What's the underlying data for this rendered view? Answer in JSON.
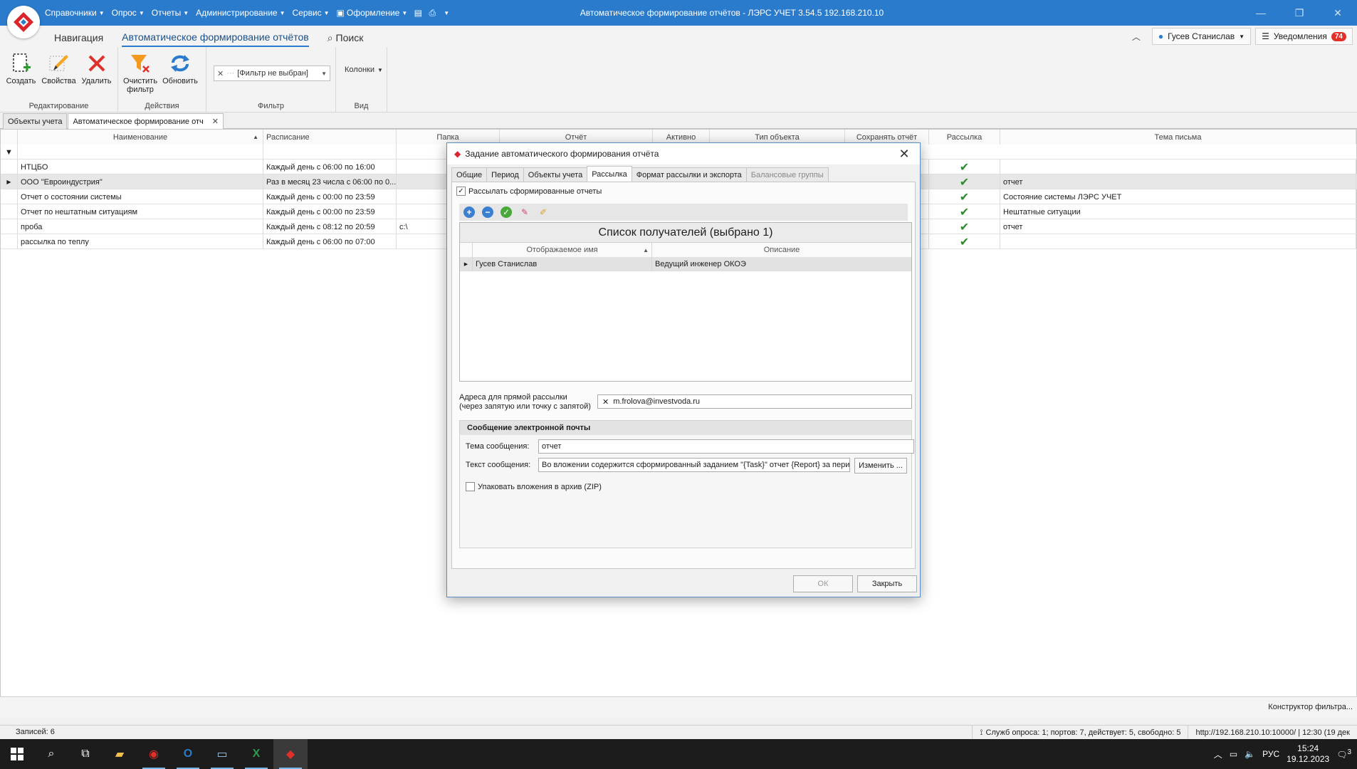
{
  "titlebar": {
    "title": "Автоматическое формирование отчётов - ЛЭРС УЧЕТ 3.54.5 192.168.210.10",
    "menus": [
      "Справочники",
      "Опрос",
      "Отчеты",
      "Администрирование",
      "Сервис",
      "Оформление"
    ],
    "minimize_label": "—",
    "maximize_label": "❐",
    "close_label": "✕"
  },
  "ribbon": {
    "tabs": [
      "Навигация",
      "Автоматическое формирование отчётов",
      "Поиск"
    ],
    "user_name": "Гусев Станислав",
    "notifications_label": "Уведомления",
    "notifications_count": "74",
    "groups": {
      "edit": {
        "label": "Редактирование",
        "create": "Создать",
        "properties": "Свойства",
        "delete": "Удалить"
      },
      "actions": {
        "label": "Действия",
        "clear_filter": "Очистить фильтр",
        "refresh": "Обновить"
      },
      "filter": {
        "label": "Фильтр",
        "value": "[Фильтр не выбран]"
      },
      "view": {
        "label": "Вид",
        "columns": "Колонки"
      }
    }
  },
  "doc_tabs": [
    "Объекты учета",
    "Автоматическое формирование отч"
  ],
  "grid": {
    "columns": [
      "Наименование",
      "Расписание",
      "Папка",
      "Отчёт",
      "Активно",
      "Тип объекта",
      "Сохранять отчёт",
      "Рассылка",
      "Тема письма"
    ],
    "rows": [
      {
        "name": "НТЦБО",
        "schedule": "Каждый день с 06:00 по 16:00",
        "folder": "",
        "subject": ""
      },
      {
        "name": "ООО \"Евроиндустрия\"",
        "schedule": "Раз в месяц 23 числа с 06:00 по 0...",
        "folder": "",
        "subject": "отчет"
      },
      {
        "name": "Отчет о состоянии системы",
        "schedule": "Каждый день с 00:00 по 23:59",
        "folder": "",
        "subject": "Состояние системы ЛЭРС УЧЕТ"
      },
      {
        "name": "Отчет по нештатным ситуациям",
        "schedule": "Каждый день с 00:00 по 23:59",
        "folder": "",
        "subject": "Нештатные ситуации"
      },
      {
        "name": "проба",
        "schedule": "Каждый день с 08:12 по 20:59",
        "folder": "c:\\",
        "subject": "отчет"
      },
      {
        "name": "рассылка по теплу",
        "schedule": "Каждый день с 06:00 по 07:00",
        "folder": "",
        "subject": ""
      }
    ],
    "filter_constructor": "Конструктор фильтра..."
  },
  "status": {
    "records": "Записей: 6",
    "polling": "Служб опроса: 1; портов: 7, действует: 5, свободно: 5",
    "server": "http://192.168.210.10:10000/ | 12:30 (19 дек"
  },
  "taskbar": {
    "lang": "РУС",
    "time": "15:24",
    "date": "19.12.2023",
    "notif_count": "3"
  },
  "dialog": {
    "title": "Задание автоматического формирования отчёта",
    "tabs": [
      "Общие",
      "Период",
      "Объекты учета",
      "Рассылка",
      "Формат рассылки и экспорта",
      "Балансовые группы"
    ],
    "send_reports_label": "Рассылать сформированные отчеты",
    "recipients_caption": "Список получателей (выбрано 1)",
    "recipients_columns": [
      "Отображаемое имя",
      "Описание"
    ],
    "recipients": [
      {
        "name": "Гусев Станислав",
        "description": "Ведущий инженер ОКОЭ"
      }
    ],
    "addr_label_1": "Адреса для прямой рассылки",
    "addr_label_2": "(через запятую или точку с запятой)",
    "addr_value": "m.frolova@investvoda.ru",
    "email_group_title": "Сообщение электронной почты",
    "subject_label": "Тема сообщения:",
    "subject_value": "отчет",
    "body_label": "Текст сообщения:",
    "body_value": "Во вложении содержится сформированный заданием \"{Task}\" отчет {Report} за пери",
    "change_button": "Изменить ...",
    "zip_label": "Упаковать вложения в архив (ZIP)",
    "ok_button": "ОК",
    "close_button": "Закрыть"
  }
}
